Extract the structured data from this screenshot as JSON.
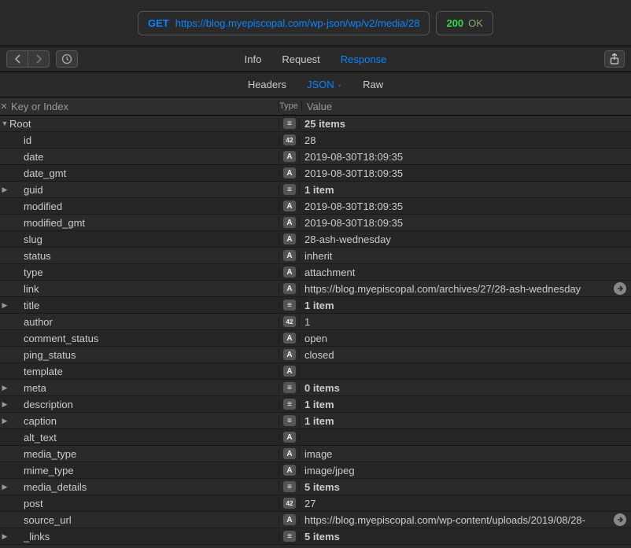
{
  "request": {
    "method": "GET",
    "url": "https://blog.myepiscopal.com/wp-json/wp/v2/media/28",
    "status_code": "200",
    "status_text": "OK"
  },
  "tabs": {
    "info": "Info",
    "request": "Request",
    "response": "Response"
  },
  "subtabs": {
    "headers": "Headers",
    "json": "JSON",
    "raw": "Raw"
  },
  "headers": {
    "key": "Key or Index",
    "type": "Type",
    "value": "Value"
  },
  "tree": [
    {
      "d": 0,
      "t": "down",
      "k": "Root",
      "ty": "obj",
      "v": "25 items",
      "b": true
    },
    {
      "d": 1,
      "t": "",
      "k": "id",
      "ty": "num",
      "v": "28"
    },
    {
      "d": 1,
      "t": "",
      "k": "date",
      "ty": "str",
      "v": "2019-08-30T18:09:35"
    },
    {
      "d": 1,
      "t": "",
      "k": "date_gmt",
      "ty": "str",
      "v": "2019-08-30T18:09:35"
    },
    {
      "d": 1,
      "t": "right",
      "k": "guid",
      "ty": "obj",
      "v": "1 item",
      "b": true
    },
    {
      "d": 1,
      "t": "",
      "k": "modified",
      "ty": "str",
      "v": "2019-08-30T18:09:35"
    },
    {
      "d": 1,
      "t": "",
      "k": "modified_gmt",
      "ty": "str",
      "v": "2019-08-30T18:09:35"
    },
    {
      "d": 1,
      "t": "",
      "k": "slug",
      "ty": "str",
      "v": "28-ash-wednesday"
    },
    {
      "d": 1,
      "t": "",
      "k": "status",
      "ty": "str",
      "v": "inherit"
    },
    {
      "d": 1,
      "t": "",
      "k": "type",
      "ty": "str",
      "v": "attachment"
    },
    {
      "d": 1,
      "t": "",
      "k": "link",
      "ty": "str",
      "v": "https://blog.myepiscopal.com/archives/27/28-ash-wednesday",
      "goto": true
    },
    {
      "d": 1,
      "t": "right",
      "k": "title",
      "ty": "obj",
      "v": "1 item",
      "b": true
    },
    {
      "d": 1,
      "t": "",
      "k": "author",
      "ty": "num",
      "v": "1"
    },
    {
      "d": 1,
      "t": "",
      "k": "comment_status",
      "ty": "str",
      "v": "open"
    },
    {
      "d": 1,
      "t": "",
      "k": "ping_status",
      "ty": "str",
      "v": "closed"
    },
    {
      "d": 1,
      "t": "",
      "k": "template",
      "ty": "str",
      "v": ""
    },
    {
      "d": 1,
      "t": "right",
      "k": "meta",
      "ty": "obj",
      "v": "0 items",
      "b": true
    },
    {
      "d": 1,
      "t": "right",
      "k": "description",
      "ty": "obj",
      "v": "1 item",
      "b": true
    },
    {
      "d": 1,
      "t": "right",
      "k": "caption",
      "ty": "obj",
      "v": "1 item",
      "b": true
    },
    {
      "d": 1,
      "t": "",
      "k": "alt_text",
      "ty": "str",
      "v": ""
    },
    {
      "d": 1,
      "t": "",
      "k": "media_type",
      "ty": "str",
      "v": "image"
    },
    {
      "d": 1,
      "t": "",
      "k": "mime_type",
      "ty": "str",
      "v": "image/jpeg"
    },
    {
      "d": 1,
      "t": "right",
      "k": "media_details",
      "ty": "obj",
      "v": "5 items",
      "b": true
    },
    {
      "d": 1,
      "t": "",
      "k": "post",
      "ty": "num",
      "v": "27"
    },
    {
      "d": 1,
      "t": "",
      "k": "source_url",
      "ty": "str",
      "v": "https://blog.myepiscopal.com/wp-content/uploads/2019/08/28-",
      "goto": true
    },
    {
      "d": 1,
      "t": "right",
      "k": "_links",
      "ty": "obj",
      "v": "5 items",
      "b": true
    }
  ],
  "type_badges": {
    "obj": "≡",
    "str": "A",
    "num": "42"
  }
}
